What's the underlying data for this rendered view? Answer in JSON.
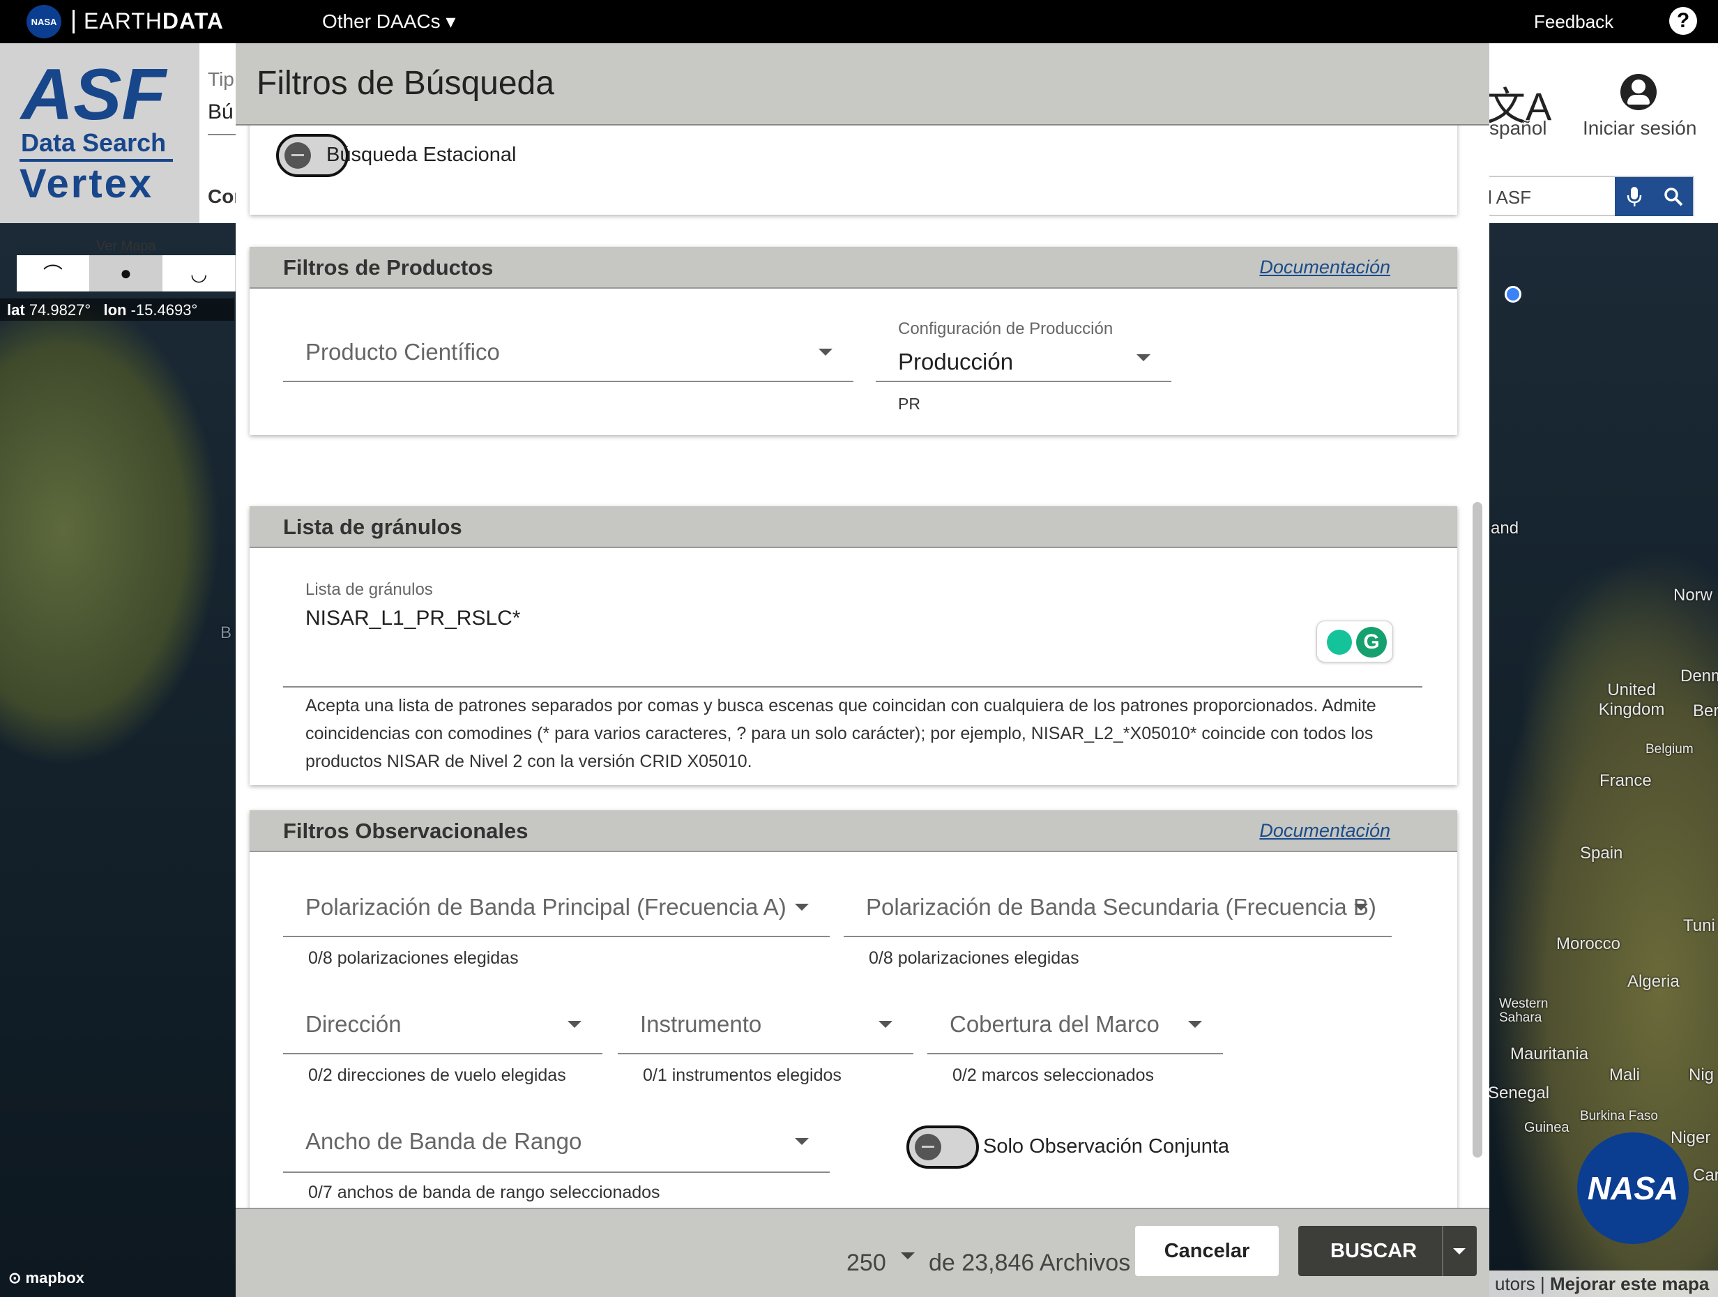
{
  "topbar": {
    "nasa_logo": "NASA",
    "earthdata_light": "EARTH",
    "earthdata_bold": "DATA",
    "other_daacs": "Other DAACs ▾",
    "feedback": "Feedback",
    "help_icon": "?"
  },
  "header": {
    "logo_asf": "ASF",
    "logo_data_search": "Data Search",
    "logo_vertex": "Vertex",
    "search_type_label": "Tip",
    "search_type_value": "Bú",
    "criteria_tab": "Cor",
    "language_icon": "文A",
    "language_label": "spañol",
    "login_label": "Iniciar sesión",
    "site_search_text": "l ASF"
  },
  "map": {
    "view_label": "Ver Mapa",
    "view_buttons": [
      "⌒",
      "●",
      "◡"
    ],
    "lat_label": "lat",
    "lat_value": "74.9827°",
    "lon_label": "lon",
    "lon_value": "-15.4693°",
    "place_labels": {
      "and": "and",
      "norw": "Norw",
      "denm": "Denm",
      "united_kingdom": "United Kingdom",
      "ber": "Ber",
      "belgium": "Belgium",
      "france": "France",
      "spain": "Spain",
      "tuni": "Tuni",
      "morocco": "Morocco",
      "algeria": "Algeria",
      "western_sahara": "Western Sahara",
      "mauritania": "Mauritania",
      "mali": "Mali",
      "nig": "Nig",
      "senegal": "Senegal",
      "burkina_faso": "Burkina Faso",
      "guinea": "Guinea",
      "niger": "Niger",
      "can": "Car",
      "b": "B"
    },
    "mapbox": "mapbox",
    "attrib_prefix": "utors |",
    "attrib_link": "Mejorar este mapa",
    "nasa_meatball": "NASA"
  },
  "dialog": {
    "title": "Filtros de Búsqueda",
    "seasonal_toggle_label": "Búsqueda Estacional",
    "product_filters": {
      "title": "Filtros de Productos",
      "doc_link": "Documentación",
      "science_product_placeholder": "Producto Científico",
      "production_config_label": "Configuración de Producción",
      "production_config_value": "Producción",
      "production_config_hint": "PR"
    },
    "granule_list": {
      "title": "Lista de gránulos",
      "field_label": "Lista de gránulos",
      "field_value": "NISAR_L1_PR_RSLC*",
      "grammarly_letter": "G",
      "help_line1": "Acepta una lista de patrones separados por comas y busca escenas que coincidan con cualquiera de los patrones proporcionados. Admite",
      "help_line2": "coincidencias con comodines (* para varios caracteres, ? para un solo carácter); por ejemplo, NISAR_L2_*X05010* coincide con todos los",
      "help_line3": "productos NISAR de Nivel 2 con la versión CRID X05010."
    },
    "observational_filters": {
      "title": "Filtros Observacionales",
      "doc_link": "Documentación",
      "main_band_placeholder": "Polarización de Banda Principal (Frecuencia A)",
      "main_band_hint": "0/8 polarizaciones elegidas",
      "secondary_band_placeholder": "Polarización de Banda Secundaria (Frecuencia B)",
      "secondary_band_hint": "0/8 polarizaciones elegidas",
      "direction_placeholder": "Dirección",
      "direction_hint": "0/2 direcciones de vuelo elegidas",
      "instrument_placeholder": "Instrumento",
      "instrument_hint": "0/1 instrumentos elegidos",
      "frame_coverage_placeholder": "Cobertura del Marco",
      "frame_coverage_hint": "0/2 marcos seleccionados",
      "range_bandwidth_placeholder": "Ancho de Banda de Rango",
      "range_bandwidth_hint": "0/7 anchos de banda de rango seleccionados",
      "joint_observation_label": "Solo Observación Conjunta"
    },
    "footer": {
      "max_results": "250",
      "of_files": "de 23,846 Archivos",
      "cancel": "Cancelar",
      "search": "BUSCAR"
    }
  },
  "colors": {
    "brand_blue": "#18468b",
    "search_button": "#1f4d8f",
    "dialog_header": "#c8c8c4",
    "search_dark": "#3d3d39",
    "link": "#1a4c8a"
  }
}
